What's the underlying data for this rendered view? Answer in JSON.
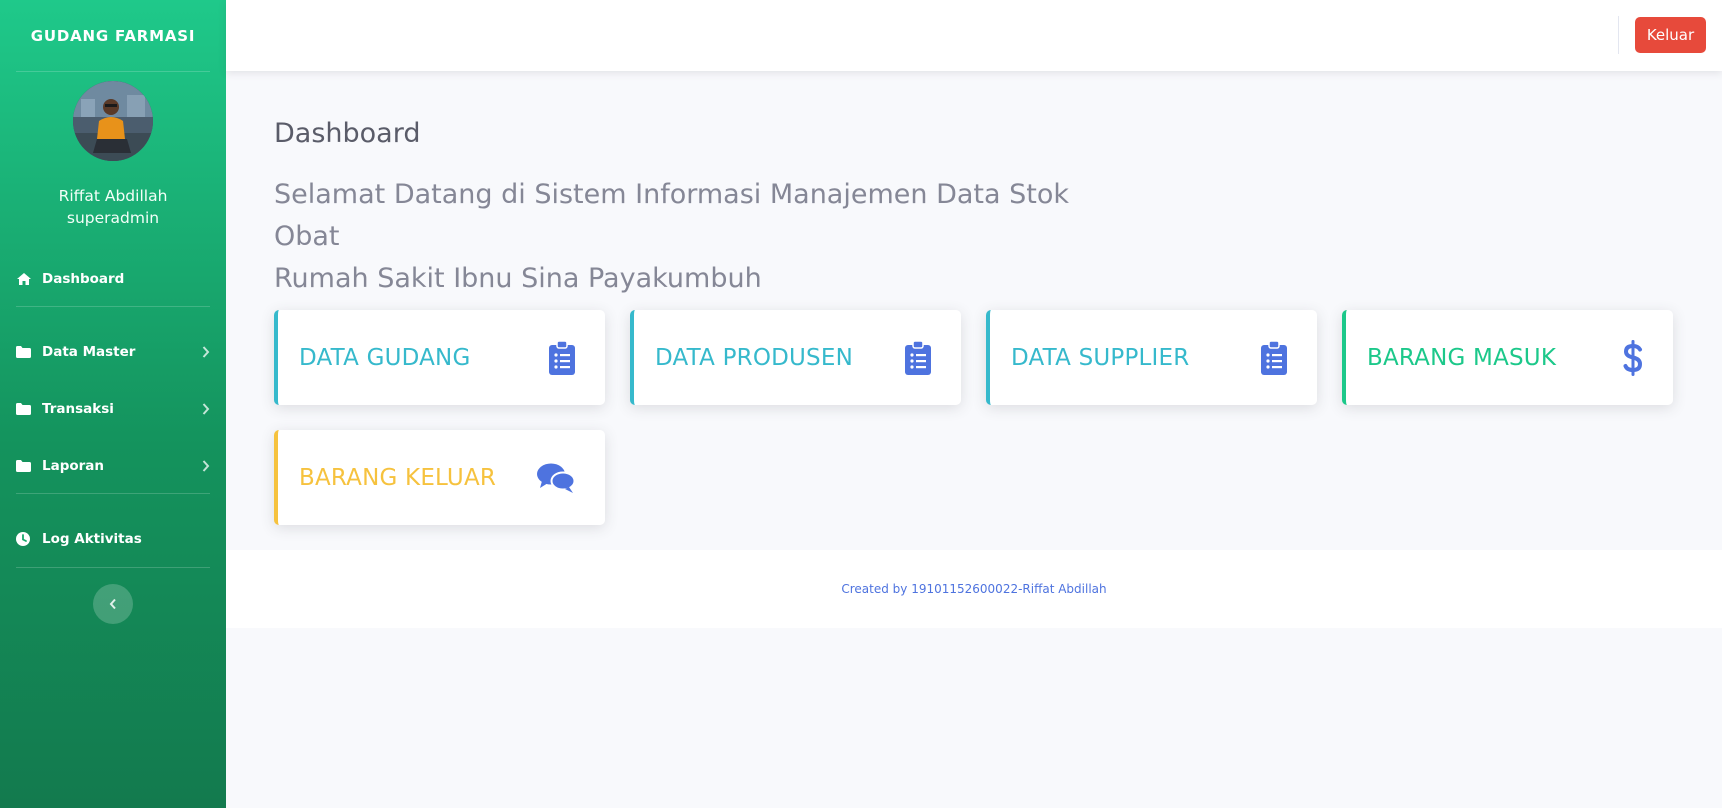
{
  "app": {
    "brand": "GUDANG FARMASI"
  },
  "user": {
    "name": "Riffat Abdillah",
    "role": "superadmin"
  },
  "sidebar": {
    "items": [
      {
        "label": "Dashboard",
        "icon": "home-icon",
        "expandable": false
      },
      {
        "label": "Data Master",
        "icon": "folder-icon",
        "expandable": true
      },
      {
        "label": "Transaksi",
        "icon": "folder-icon",
        "expandable": true
      },
      {
        "label": "Laporan",
        "icon": "folder-icon",
        "expandable": true
      },
      {
        "label": "Log Aktivitas",
        "icon": "clock-icon",
        "expandable": false
      }
    ],
    "toggle_icon": "chevron-left-icon"
  },
  "topbar": {
    "logout_label": "Keluar"
  },
  "main": {
    "page_title": "Dashboard",
    "welcome_line1": "Selamat Datang di Sistem Informasi Manajemen Data Stok Obat",
    "welcome_line2": "Rumah Sakit Ibnu Sina Payakumbuh",
    "cards": [
      {
        "title": "DATA GUDANG",
        "icon": "clipboard-list-icon",
        "variant": "info"
      },
      {
        "title": "DATA PRODUSEN",
        "icon": "clipboard-list-icon",
        "variant": "info"
      },
      {
        "title": "DATA SUPPLIER",
        "icon": "clipboard-list-icon",
        "variant": "info"
      },
      {
        "title": "BARANG MASUK",
        "icon": "dollar-icon",
        "variant": "success"
      },
      {
        "title": "BARANG KELUAR",
        "icon": "comments-icon",
        "variant": "warning"
      }
    ]
  },
  "footer": {
    "credit": "Created by 19101152600022-Riffat Abdillah"
  },
  "colors": {
    "primary": "#4e73df",
    "info": "#36b9cc",
    "success": "#1cc88a",
    "warning": "#f6c23e",
    "danger": "#e74a3b",
    "sidebar_top": "#1fc98a",
    "sidebar_bottom": "#137a4e"
  }
}
